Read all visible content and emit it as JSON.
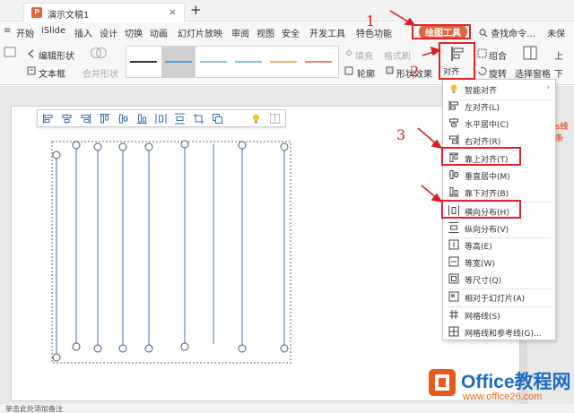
{
  "titlebar": {
    "document_title": "演示文稿1",
    "close_glyph": "×",
    "new_tab_glyph": "+"
  },
  "menu": {
    "toggle": "≡",
    "items": [
      "开始",
      "iSlide",
      "插入",
      "设计",
      "切换",
      "动画",
      "幻灯片放映",
      "审阅",
      "视图",
      "安全",
      "开发工具",
      "特色功能"
    ],
    "active_tab": "绘图工具",
    "search": "查找命令...",
    "more": "未保"
  },
  "ribbon": {
    "edit_shape": "编辑形状",
    "text_box": "文本框",
    "merge_shape": "合并形状",
    "fill": "填充",
    "format_painter": "格式刷",
    "outline": "轮廓",
    "shape_effect": "形状效果",
    "align": "对齐",
    "group": "组合",
    "rotate": "旋转",
    "selection_pane": "选择窗格",
    "up_partial": "上",
    "down_partial": "下",
    "line_colors": [
      "#333333",
      "#5b9bd5",
      "#8fbfe8",
      "#7fc6e0",
      "#f0b070",
      "#f08080"
    ]
  },
  "mini_toolbar": {
    "icons": [
      "align-left-icon",
      "align-center-h-icon",
      "align-right-icon",
      "align-top-icon",
      "align-middle-v-icon",
      "align-bottom-icon",
      "distribute-h-icon",
      "distribute-v-icon",
      "crop-icon",
      "group-icon",
      "lightbulb-icon",
      "table-icon"
    ]
  },
  "dropdown": {
    "items": [
      {
        "label": "智能对齐",
        "icon": "lightbulb-icon",
        "has_submenu": true
      },
      {
        "label": "左对齐(L)",
        "icon": "align-left-icon"
      },
      {
        "label": "水平居中(C)",
        "icon": "align-center-h-icon"
      },
      {
        "label": "右对齐(R)",
        "icon": "align-right-icon"
      },
      {
        "label": "靠上对齐(T)",
        "icon": "align-top-icon"
      },
      {
        "label": "垂直居中(M)",
        "icon": "align-middle-v-icon"
      },
      {
        "label": "靠下对齐(B)",
        "icon": "align-bottom-icon"
      },
      {
        "label": "横向分布(H)",
        "icon": "distribute-h-icon"
      },
      {
        "label": "纵向分布(V)",
        "icon": "distribute-v-icon"
      },
      {
        "label": "等高(E)",
        "icon": "equal-height-icon"
      },
      {
        "label": "等宽(W)",
        "icon": "equal-width-icon"
      },
      {
        "label": "等尺寸(Q)",
        "icon": "equal-size-icon"
      },
      {
        "label": "相对于幻灯片(A)",
        "icon": "relative-slide-icon"
      },
      {
        "label": "网格线(S)",
        "icon": "grid-icon"
      },
      {
        "label": "网格线和参考线(G)...",
        "icon": "grid-guides-icon"
      }
    ],
    "submenu_arrow": "›"
  },
  "annotations": {
    "step1": "1",
    "step2": "2",
    "step3": "3",
    "color": "#d81f26"
  },
  "side_peek": "s线条",
  "status": {
    "text": "单击此处添加备注"
  },
  "watermark": {
    "title": "Office教程网",
    "url": "www.office26.com"
  },
  "colors": {
    "accent": "#e8623c",
    "line_blue": "#7aa6d6",
    "highlight": "#e0242a"
  }
}
